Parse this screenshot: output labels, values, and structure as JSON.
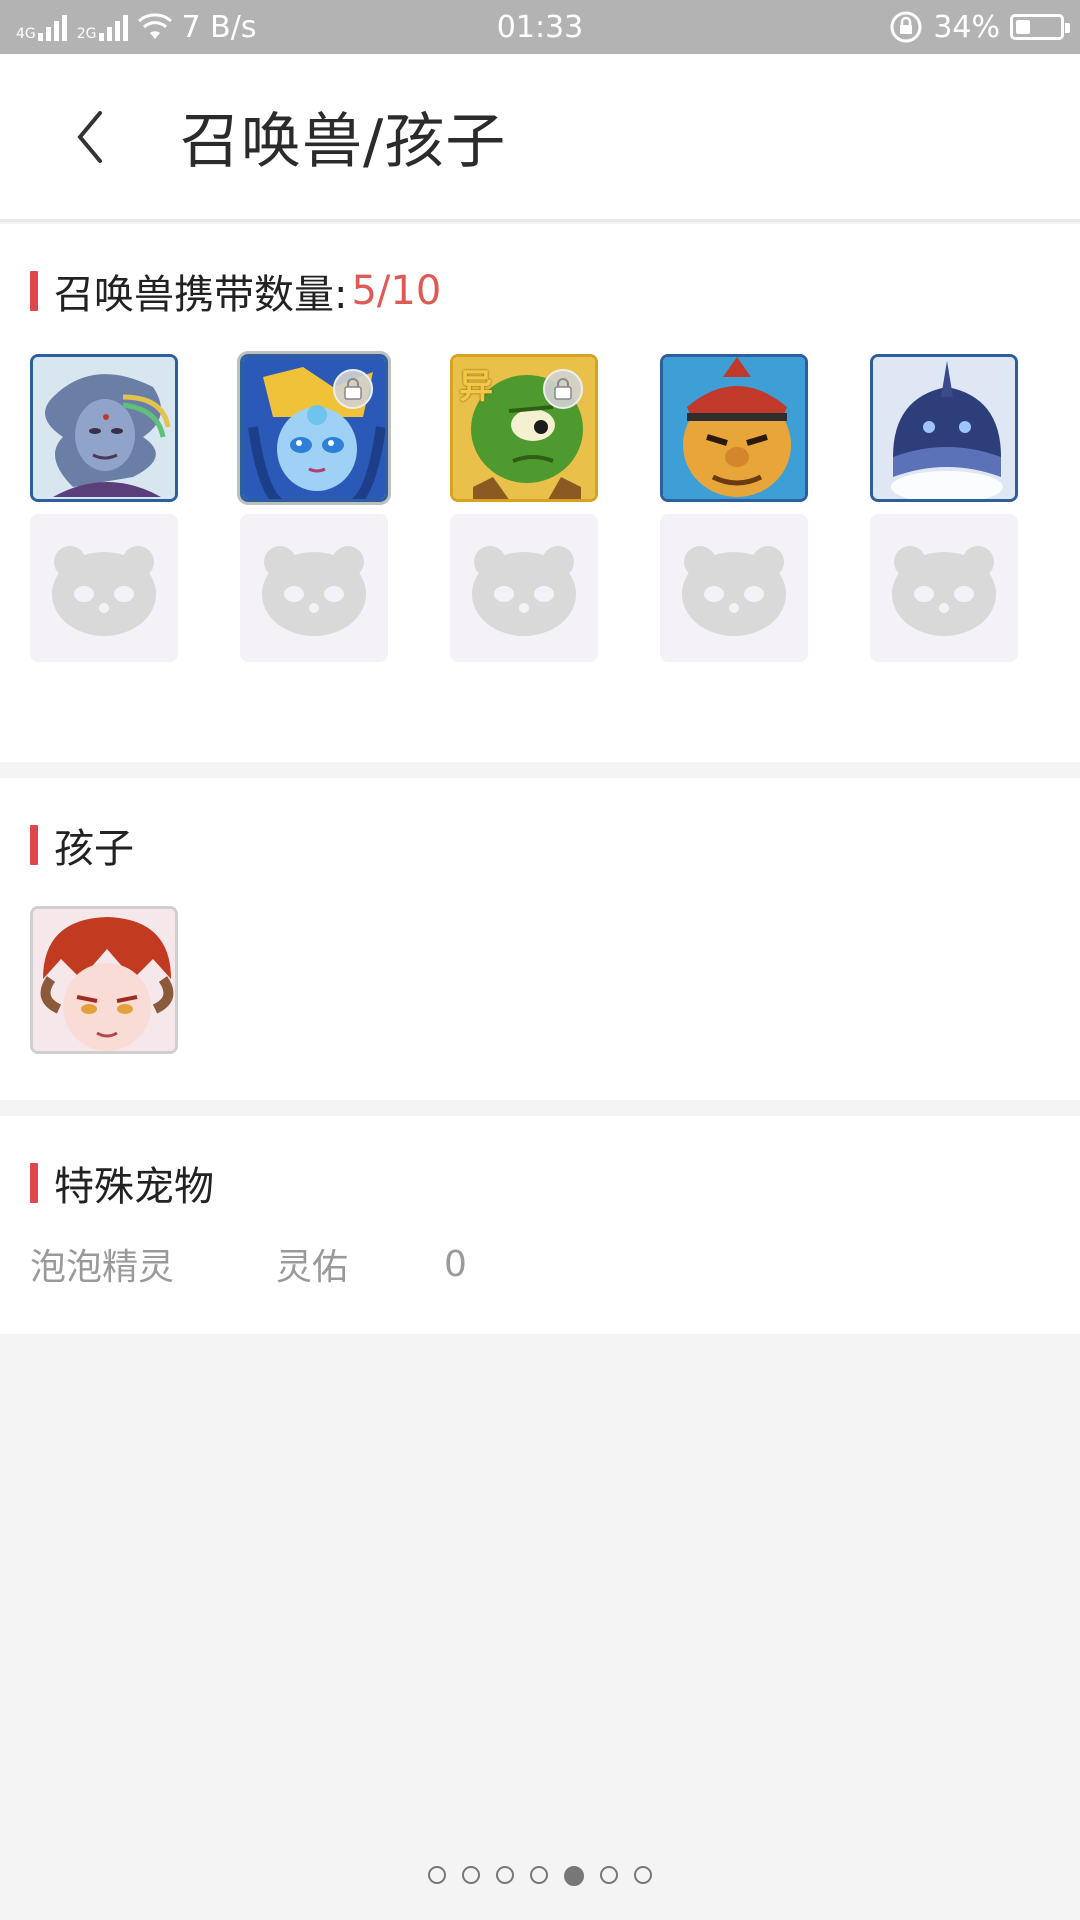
{
  "status_bar": {
    "network_1": "4G",
    "network_2": "2G",
    "speed": "7 B/s",
    "time": "01:33",
    "battery": "34%"
  },
  "header": {
    "title": "召唤兽/孩子"
  },
  "summon": {
    "label": "召唤兽携带数量:",
    "count": "5/10",
    "pets": [
      {
        "icon": "pet-avatar-sea-spirit-icon",
        "locked": false
      },
      {
        "icon": "pet-avatar-blue-mermaid-icon",
        "locked": true
      },
      {
        "icon": "pet-avatar-green-alien-icon",
        "locked": true,
        "badge": "异"
      },
      {
        "icon": "pet-avatar-bandana-brute-icon",
        "locked": false
      },
      {
        "icon": "pet-avatar-blue-armor-icon",
        "locked": false
      }
    ],
    "empty_slots": 5
  },
  "children": {
    "label": "孩子",
    "items": [
      {
        "icon": "child-avatar-horned-red-hair-icon"
      }
    ]
  },
  "special": {
    "label": "特殊宠物",
    "items": [
      {
        "name": "泡泡精灵",
        "kind": "灵佑",
        "value": "0"
      }
    ]
  },
  "pager": {
    "count": 7,
    "active": 4
  },
  "colors": {
    "accent": "#e0474c",
    "count": "#df5a55",
    "pet_border_blue": "#2d5f9c",
    "pet_border_gold": "#d7a21f"
  }
}
